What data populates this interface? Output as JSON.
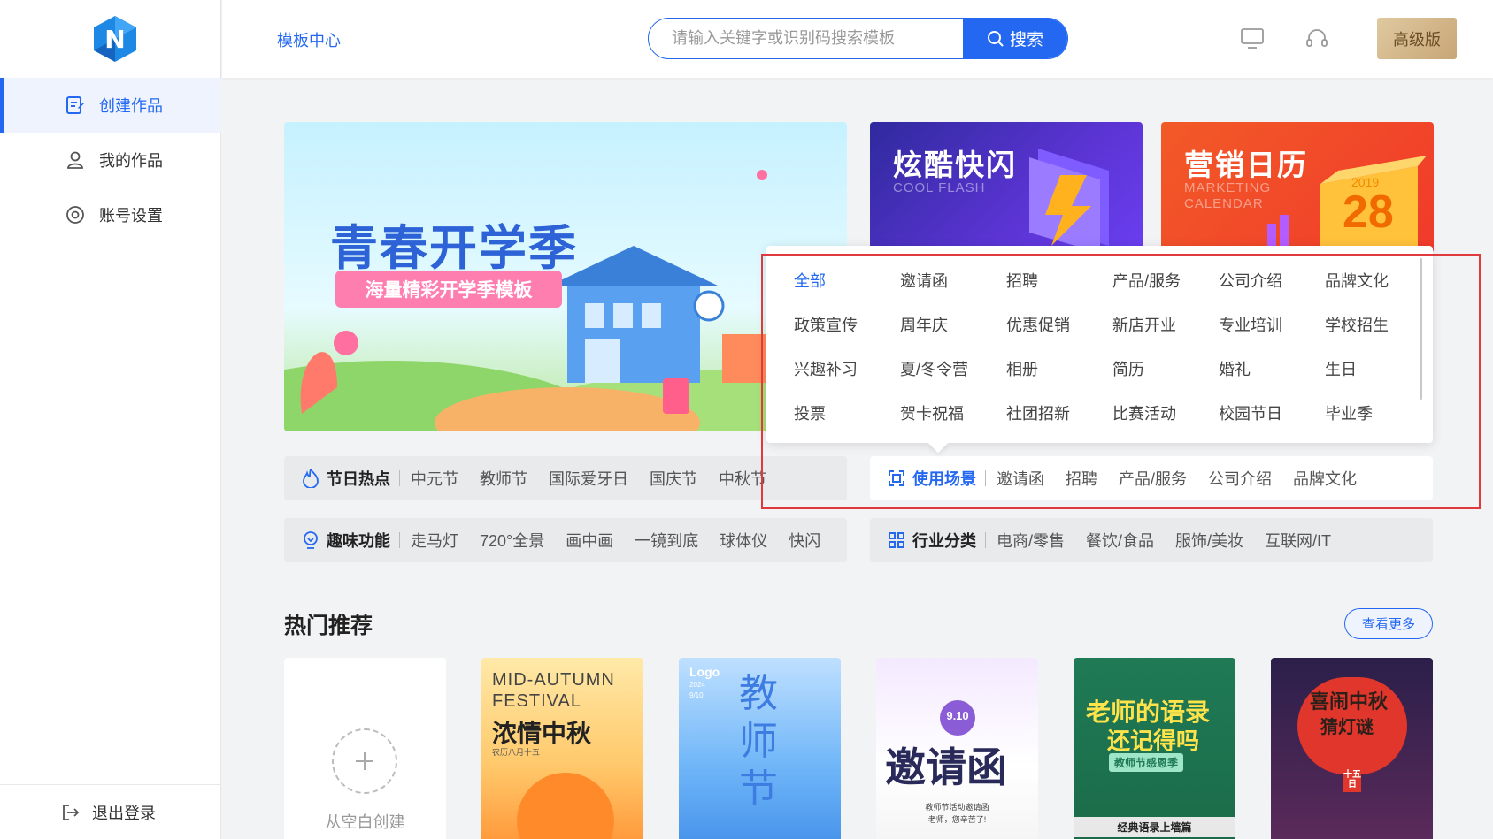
{
  "sidebar": {
    "logo_letter": "N",
    "items": [
      {
        "label": "创建作品",
        "icon": "edit-doc-icon",
        "active": true
      },
      {
        "label": "我的作品",
        "icon": "user-icon",
        "active": false
      },
      {
        "label": "账号设置",
        "icon": "settings-icon",
        "active": false
      }
    ],
    "logout_label": "退出登录"
  },
  "header": {
    "breadcrumb": "模板中心",
    "search_placeholder": "请输入关键字或识别码搜索模板",
    "search_button": "搜索",
    "vip_button": "高级版"
  },
  "banners": {
    "main_title": "青春开学季",
    "main_subtitle": "海量精彩开学季模板",
    "side1_title": "炫酷快闪",
    "side1_sub": "COOL FLASH",
    "side2_title": "营销日历",
    "side2_sub": "MARKETING CALENDAR",
    "side2_year": "2019",
    "side2_day": "28"
  },
  "bars": {
    "holiday": {
      "title": "节日热点",
      "tags": [
        "中元节",
        "教师节",
        "国际爱牙日",
        "国庆节",
        "中秋节"
      ]
    },
    "scene": {
      "title": "使用场景",
      "tags": [
        "邀请函",
        "招聘",
        "产品/服务",
        "公司介绍",
        "品牌文化"
      ]
    },
    "fun": {
      "title": "趣味功能",
      "tags": [
        "走马灯",
        "720°全景",
        "画中画",
        "一镜到底",
        "球体仪",
        "快闪"
      ]
    },
    "industry": {
      "title": "行业分类",
      "tags": [
        "电商/零售",
        "餐饮/食品",
        "服饰/美妆",
        "互联网/IT"
      ]
    }
  },
  "popover": {
    "items": [
      "全部",
      "邀请函",
      "招聘",
      "产品/服务",
      "公司介绍",
      "品牌文化",
      "政策宣传",
      "周年庆",
      "优惠促销",
      "新店开业",
      "专业培训",
      "学校招生",
      "兴趣补习",
      "夏/冬令营",
      "相册",
      "简历",
      "婚礼",
      "生日",
      "投票",
      "贺卡祝福",
      "社团招新",
      "比赛活动",
      "校园节日",
      "毕业季"
    ],
    "active_index": 0
  },
  "hot": {
    "title": "热门推荐",
    "more_button": "查看更多",
    "blank_label": "从空白创建",
    "cards": [
      {
        "line1": "MID-AUTUMN",
        "line2": "FESTIVAL",
        "line3": "浓情中秋",
        "line4": "农历八月十五"
      },
      {
        "line1": "Logo",
        "line2": "2024",
        "line3": "9/10",
        "line4": "教师节"
      },
      {
        "line1": "9.10",
        "line2": "邀请函",
        "line3": "教师节活动邀请函",
        "line4": "老师，您辛苦了!"
      },
      {
        "line1": "老师的语录",
        "line2": "还记得吗",
        "line3": "教师节感恩季",
        "line4": "经典语录上墙篇"
      },
      {
        "line1": "喜闹中秋",
        "line2": "猜灯谜",
        "line3": "十五日",
        "line4": ""
      }
    ]
  },
  "colors": {
    "primary": "#2468f2",
    "highlight": "#e0393e",
    "vip": "#c7a676"
  }
}
